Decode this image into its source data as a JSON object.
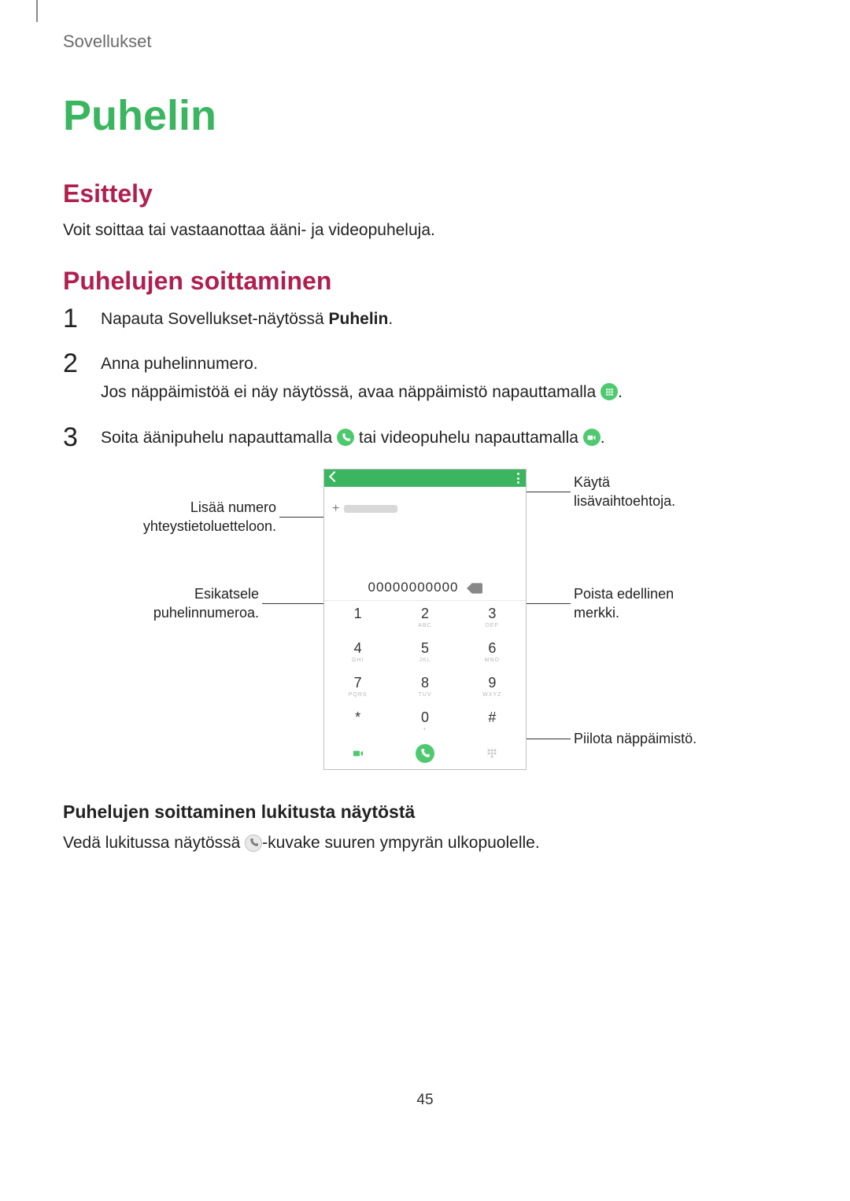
{
  "breadcrumb": "Sovellukset",
  "title": "Puhelin",
  "section1": {
    "heading": "Esittely",
    "body": "Voit soittaa tai vastaanottaa ääni- ja videopuheluja."
  },
  "section2": {
    "heading": "Puhelujen soittaminen",
    "steps": {
      "1": {
        "num": "1",
        "pre": "Napauta Sovellukset-näytössä ",
        "bold": "Puhelin",
        "post": "."
      },
      "2": {
        "num": "2",
        "line1": "Anna puhelinnumero.",
        "line2_pre": "Jos näppäimistöä ei näy näytössä, avaa näppäimistö napauttamalla ",
        "line2_post": "."
      },
      "3": {
        "num": "3",
        "pre": "Soita äänipuhelu napauttamalla ",
        "mid": " tai videopuhelu napauttamalla ",
        "post": "."
      }
    }
  },
  "figure": {
    "callouts": {
      "add_contact": "Lisää numero yhteystietoluetteloon.",
      "preview_number": "Esikatsele puhelinnumeroa.",
      "more_options": "Käytä lisävaihtoehtoja.",
      "delete_char": "Poista edellinen merkki.",
      "hide_keypad": "Piilota näppäimistö."
    },
    "phone": {
      "number": "00000000000",
      "keys": [
        [
          {
            "d": "1",
            "s": ""
          },
          {
            "d": "2",
            "s": "ABC"
          },
          {
            "d": "3",
            "s": "DEF"
          }
        ],
        [
          {
            "d": "4",
            "s": "GHI"
          },
          {
            "d": "5",
            "s": "JKL"
          },
          {
            "d": "6",
            "s": "MNO"
          }
        ],
        [
          {
            "d": "7",
            "s": "PQRS"
          },
          {
            "d": "8",
            "s": "TUV"
          },
          {
            "d": "9",
            "s": "WXYZ"
          }
        ],
        [
          {
            "d": "*",
            "s": ""
          },
          {
            "d": "0",
            "s": "+"
          },
          {
            "d": "#",
            "s": ""
          }
        ]
      ]
    }
  },
  "subsection": {
    "heading": "Puhelujen soittaminen lukitusta näytöstä",
    "body_pre": "Vedä lukitussa näytössä ",
    "body_post": "-kuvake suuren ympyrän ulkopuolelle."
  },
  "page_number": "45"
}
